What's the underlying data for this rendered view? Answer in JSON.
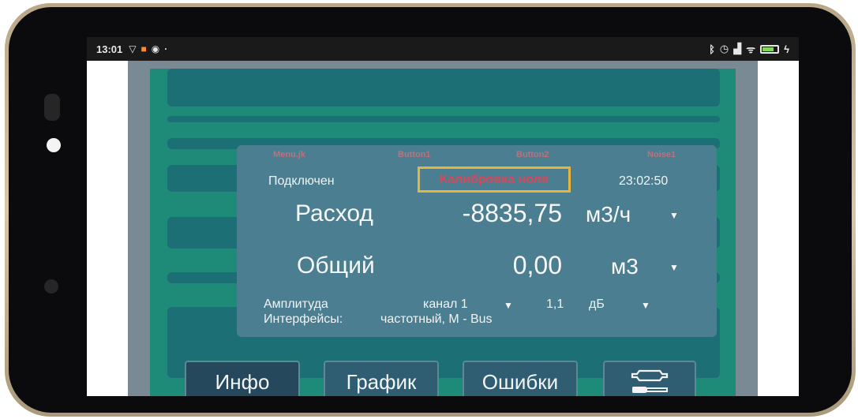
{
  "statusbar": {
    "time": "13:01",
    "icons_left": [
      "wifi-signal-icon",
      "app-icon",
      "chrome-icon"
    ],
    "icons_right": [
      "bluetooth-icon",
      "alarm-icon",
      "signal-icon",
      "wifi-icon",
      "battery-icon"
    ]
  },
  "panel": {
    "faint_labels": [
      "Мenu.jk",
      "Button1",
      "Button2",
      "Noise1"
    ],
    "connection_status": "Подключен",
    "mode": "Калибровка ноля",
    "time": "23:02:50",
    "flow": {
      "label": "Расход",
      "value": "-8835,75",
      "unit": "м3/ч"
    },
    "total": {
      "label": "Общий",
      "value": "0,00",
      "unit": "м3"
    },
    "amplitude": {
      "label": "Амплитуда",
      "channel": "канал 1",
      "value": "1,1",
      "unit": "дБ"
    },
    "interfaces": {
      "label": "Интерфейсы:",
      "value": "частотный, М - Bus"
    }
  },
  "buttons": {
    "info": "Инфо",
    "chart": "График",
    "errors": "Ошибки",
    "settings_icon": "wrench-screwdriver-icon"
  },
  "colors": {
    "app_background": "#1e8a78",
    "panel": "#4a7e90",
    "highlight_border": "#e6b43a",
    "mode_text": "#d24a5c"
  }
}
